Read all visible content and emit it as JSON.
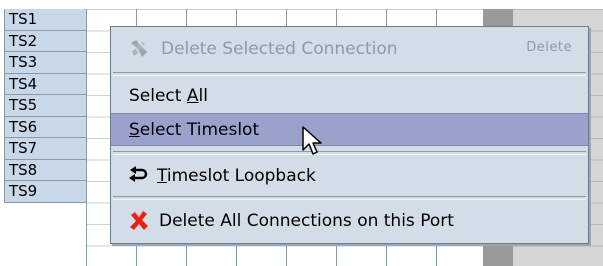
{
  "timeslots": [
    "TS1",
    "TS2",
    "TS3",
    "TS4",
    "TS5",
    "TS6",
    "TS7",
    "TS8",
    "TS9"
  ],
  "context_menu": {
    "delete_selected": {
      "label": "Delete Selected Connection",
      "shortcut": "Delete",
      "enabled": false,
      "icon": "broken-plug-icon"
    },
    "select_all": {
      "prefix": "Select ",
      "mnemonic": "A",
      "suffix": "ll"
    },
    "select_timeslot": {
      "mnemonic": "S",
      "suffix": "elect Timeslot",
      "highlighted": true
    },
    "timeslot_loopback": {
      "mnemonic": "T",
      "suffix": "imeslot Loopback",
      "icon": "loopback-arrow-icon"
    },
    "delete_all": {
      "label": "Delete All Connections on this Port",
      "icon": "red-x-icon"
    }
  },
  "colors": {
    "row_header_bg": "#c9d8e8",
    "menu_bg": "#d3dde8",
    "highlight_bg": "#9aa2cc",
    "disabled_text": "#8e9aa6",
    "delete_icon_red": "#e8201a"
  }
}
